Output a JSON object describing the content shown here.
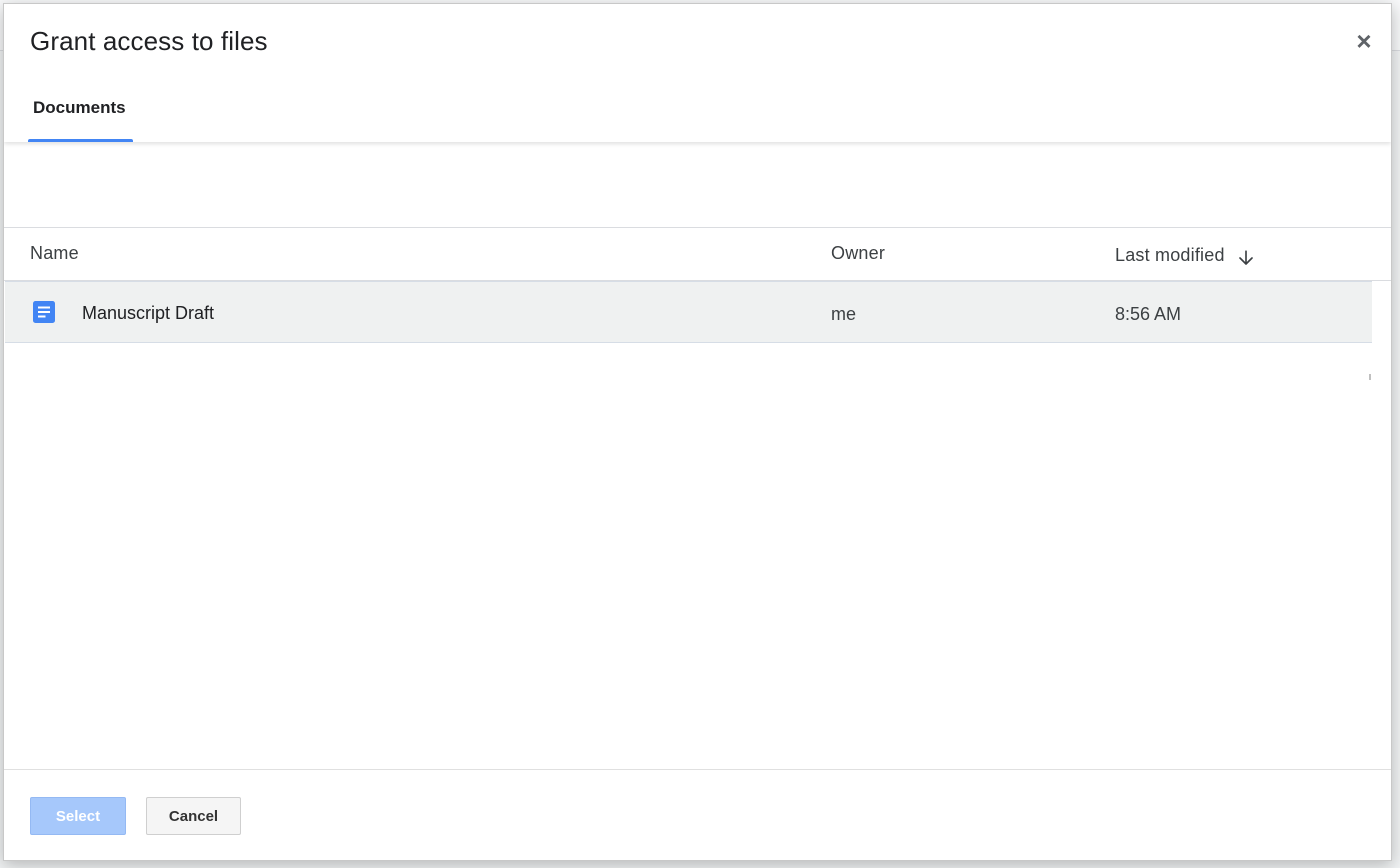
{
  "dialog": {
    "title": "Grant access to files",
    "close_symbol": "×",
    "tabs": [
      {
        "label": "Documents",
        "active": true
      }
    ]
  },
  "table": {
    "columns": {
      "name": "Name",
      "owner": "Owner",
      "last_modified": "Last modified"
    },
    "sort_icon": "arrow-down-icon",
    "rows": [
      {
        "icon": "google-docs-icon",
        "name": "Manuscript Draft",
        "owner": "me",
        "modified": "8:56 AM"
      }
    ]
  },
  "footer": {
    "select_label": "Select",
    "cancel_label": "Cancel"
  },
  "colors": {
    "accent": "#4285f4",
    "select_button_disabled": "#a6c8fb",
    "selected_row": "#eff1f1",
    "doc_icon": "#4285f4"
  }
}
